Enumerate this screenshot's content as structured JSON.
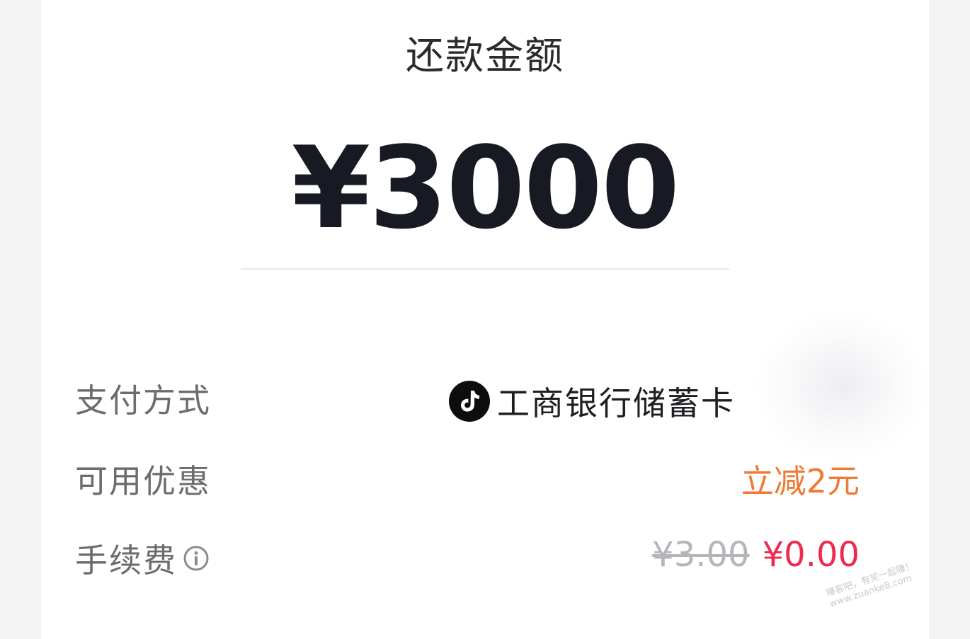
{
  "header": {
    "title": "还款金额"
  },
  "amount": {
    "value": "¥3000"
  },
  "rows": {
    "payment_method": {
      "label": "支付方式",
      "value": "工商银行储蓄卡",
      "icon": "douyin-brand-icon"
    },
    "discount": {
      "label": "可用优惠",
      "value": "立减2元"
    },
    "fee": {
      "label": "手续费",
      "original": "¥3.00",
      "current": "¥0.00",
      "icon": "info-icon"
    }
  },
  "watermark": {
    "line1": "赚客吧，有奖一起赚！",
    "line2": "www.zuanke8.com"
  },
  "colors": {
    "discount": "#f07a34",
    "fee_current": "#ee2a4e",
    "fee_original": "#b5b5ba",
    "amount": "#171a22"
  }
}
